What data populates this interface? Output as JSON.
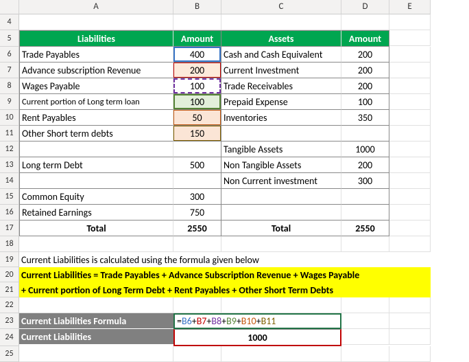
{
  "columns": [
    "A",
    "B",
    "C",
    "D",
    "E"
  ],
  "first_row_number": 4,
  "last_row_number": 25,
  "chart_data": {
    "type": "table",
    "headers": {
      "a": "Liabilities",
      "b": "Amount",
      "c": "Assets",
      "d": "Amount"
    },
    "rows": [
      {
        "a": "Trade Payables",
        "b": 400,
        "c": "Cash and Cash Equivalent",
        "d": 200
      },
      {
        "a": "Advance subscription Revenue",
        "b": 200,
        "c": "Current Investment",
        "d": 200
      },
      {
        "a": "Wages Payable",
        "b": 100,
        "c": "Trade Receivables",
        "d": 200
      },
      {
        "a": "Current portion of Long term loan",
        "b": 100,
        "c": "Prepaid Expense",
        "d": 100
      },
      {
        "a": "Rent Payables",
        "b": 50,
        "c": "Inventories",
        "d": 350
      },
      {
        "a": "Other Short term debts",
        "b": 150,
        "c": "",
        "d": ""
      },
      {
        "a": "",
        "b": "",
        "c": "Tangible Assets",
        "d": 1000
      },
      {
        "a": "Long term Debt",
        "b": 500,
        "c": "Non Tangible Assets",
        "d": 200
      },
      {
        "a": "",
        "b": "",
        "c": "Non Current investment",
        "d": 300
      },
      {
        "a": "Common Equity",
        "b": 300,
        "c": "",
        "d": ""
      },
      {
        "a": "Retained Earnings",
        "b": 750,
        "c": "",
        "d": ""
      }
    ],
    "totals": {
      "a": "Total",
      "b": 2550,
      "c": "Total",
      "d": 2550
    }
  },
  "explain_text": "Current Liabilities is calculated using the formula given below",
  "formula_text": {
    "line1": "Current Liabilities = Trade Payables + Advance Subscription Revenue + Wages Payable",
    "line2": " + Current portion of Long Term Debt + Rent Payables + Other Short Term Debts"
  },
  "results": {
    "label1": "Current Liabilities Formula",
    "label2": "Current Liabilities",
    "value": 1000
  },
  "formula_tokens": {
    "eq": "=",
    "b6": "B6",
    "b7": "B7",
    "b8": "B8",
    "b9": "B9",
    "b10": "B10",
    "b11": "B11",
    "plus": "+"
  }
}
